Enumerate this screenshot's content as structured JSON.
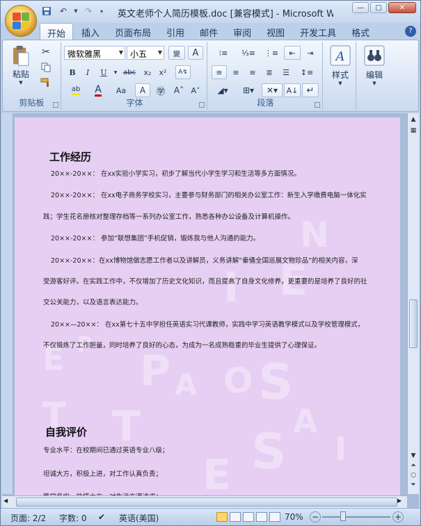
{
  "window": {
    "title": "英文老师个人简历模板.doc [兼容模式] - Microsoft W...",
    "minimize": "—",
    "maximize": "□",
    "close": "✕"
  },
  "qat": {
    "save_icon": "save-icon",
    "undo_icon": "undo-icon",
    "redo_icon": "redo-icon"
  },
  "tabs": [
    "开始",
    "插入",
    "页面布局",
    "引用",
    "邮件",
    "审阅",
    "视图",
    "开发工具",
    "格式"
  ],
  "ribbon": {
    "clipboard": {
      "label": "剪贴板",
      "paste": "粘贴"
    },
    "font": {
      "label": "字体",
      "font_name": "微软雅黑",
      "font_size": "小五"
    },
    "paragraph": {
      "label": "段落"
    },
    "styles": {
      "label": "样式"
    },
    "editing": {
      "label": "编辑"
    }
  },
  "document": {
    "section1_title": "工作经历",
    "p1": "20××-20××： 在xx实验小学实习，初步了解当代小学生学习和生活等多方面情况。",
    "p2a": "20××-20××： 在xx电子商务学校实习，主要参与财务部门的相关办公室工作：新生入学缴费电脑一体化实",
    "p2b": "践；学生花名册核对整理存档等一系列办公室工作，熟悉各种办公设备及计算机操作。",
    "p3": "20××-20××： 参加“联想集团”手机促销，锻炼我与他人沟通的能力。",
    "p4a": "20××-20××：在xx博物馆做志愿工作者以及讲解员，义务讲解“秦俑全国巡展文物珍品”的相关内容，深",
    "p4b": "受游客好评。在实践工作中，不仅增加了历史文化知识，而且提高了自身文化修养，更重要的是培养了良好的社",
    "p4c": "交公关能力，以及语言表达能力。",
    "p5a": "20××—20××： 在xx第七十五中学担任英语实习代课教师，实践中学习英语教学模式以及学校管理模式，",
    "p5b": "不仅锻炼了工作胆量，同时培养了良好的心态，为成为一名成熟稳重的毕业生提供了心理保证。",
    "section2_title": "自我评价",
    "e1": "专业水平：在校期间已通过英语专业八级；",
    "e2": "坦诚大方，积极上进，对工作认真负责；",
    "e3": "笃学务实，热情大方，对生活充满追求；"
  },
  "statusbar": {
    "page": "页面: 2/2",
    "words": "字数: 0",
    "language": "英语(美国)",
    "zoom": "70%"
  },
  "colors": {
    "page_background": "#e6cff3",
    "ribbon_accent": "#1e395b",
    "font_color_red": "#d00000"
  }
}
